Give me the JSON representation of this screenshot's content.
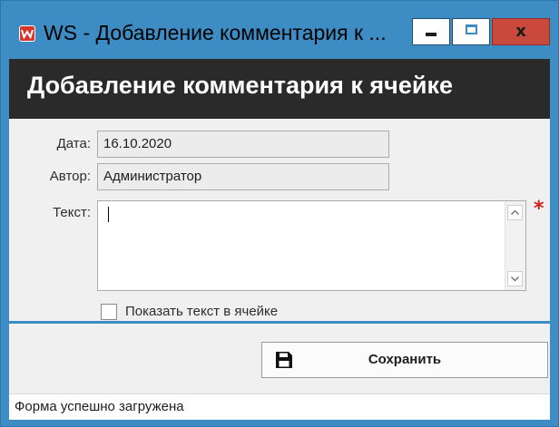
{
  "window": {
    "title": "WS - Добавление комментария к ...",
    "minimize_icon": "minimize-icon",
    "maximize_icon": "maximize-icon",
    "close_glyph": "x"
  },
  "header": {
    "title": "Добавление комментария к ячейке"
  },
  "form": {
    "date_label": "Дата:",
    "date_value": "16.10.2020",
    "author_label": "Автор:",
    "author_value": "Администратор",
    "text_label": "Текст:",
    "text_value": "",
    "required_mark": "*",
    "scroll_up": "^",
    "scroll_down": "v",
    "show_text_label": "Показать текст в ячейке",
    "show_text_checked": false
  },
  "actions": {
    "save_label": "Сохранить",
    "save_icon": "floppy-disk-icon"
  },
  "status": {
    "message": "Форма успешно загружена"
  },
  "colors": {
    "frame": "#3d8dc4",
    "header_band": "#2a2a2a",
    "close_button": "#c94a3d",
    "required": "#d21e1e"
  }
}
